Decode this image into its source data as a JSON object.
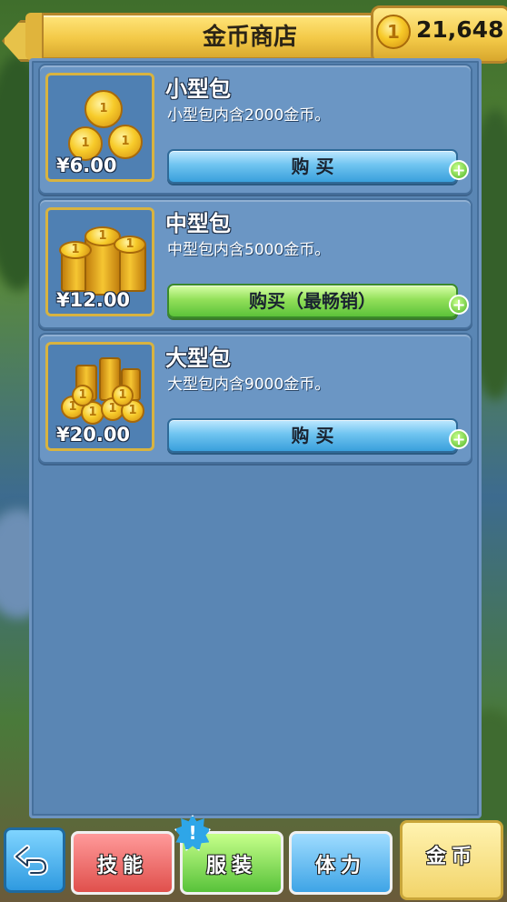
{
  "header": {
    "title": "金币商店",
    "coin_balance": "21,648",
    "coin_symbol": "1"
  },
  "items": [
    {
      "name": "小型包",
      "description": "小型包内含2000金币。",
      "price": "¥6.00",
      "button_label": "购 买",
      "button_style": "blue"
    },
    {
      "name": "中型包",
      "description": "中型包内含5000金币。",
      "price": "¥12.00",
      "button_label": "购买（最畅销）",
      "button_style": "green"
    },
    {
      "name": "大型包",
      "description": "大型包内含9000金币。",
      "price": "¥20.00",
      "button_label": "购 买",
      "button_style": "blue"
    }
  ],
  "bottom_tabs": {
    "back_icon": "back-arrow-icon",
    "skill": "技能",
    "costume": "服装",
    "costume_badge": "!",
    "energy": "体力",
    "coins": "金币"
  },
  "colors": {
    "panel": "#5a86b4",
    "gold": "#f3c947",
    "buy_blue": "#3aa0dc",
    "buy_green": "#5cc23a"
  }
}
